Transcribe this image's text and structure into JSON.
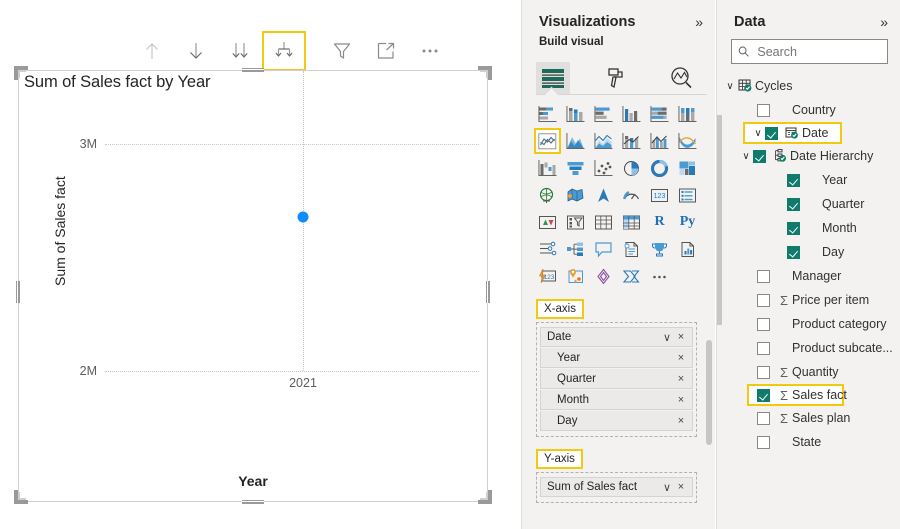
{
  "visual": {
    "title": "Sum of Sales fact by Year",
    "toolbar": [
      {
        "name": "drill-up-icon",
        "label": "Drill up",
        "state": "disabled",
        "selected": false
      },
      {
        "name": "drill-down-toggle-icon",
        "label": "Drill down",
        "state": "enabled",
        "selected": false
      },
      {
        "name": "go-to-next-level-icon",
        "label": "Go to the next level in the hierarchy",
        "state": "enabled",
        "selected": false
      },
      {
        "name": "expand-all-down-icon",
        "label": "Expand all down one level in the hierarchy",
        "state": "enabled",
        "selected": true
      },
      {
        "name": "filter-icon",
        "label": "Filters",
        "state": "enabled",
        "selected": false
      },
      {
        "name": "focus-mode-icon",
        "label": "Focus mode",
        "state": "enabled",
        "selected": false
      },
      {
        "name": "more-options-icon",
        "label": "More options",
        "state": "enabled",
        "selected": false
      }
    ]
  },
  "chart_data": {
    "type": "scatter",
    "title": "Sum of Sales fact by Year",
    "xlabel": "Year",
    "ylabel": "Sum of Sales fact",
    "x_ticks": [
      "2021"
    ],
    "y_ticks": [
      "2M",
      "3M"
    ],
    "ylim": [
      1800000,
      3200000
    ],
    "grid": true,
    "legend": false,
    "series": [
      {
        "name": "Sum of Sales fact",
        "color": "#118DFF",
        "points": [
          {
            "x": "2021",
            "y": 2500000
          }
        ]
      }
    ]
  },
  "visualizations_panel": {
    "title": "Visualizations",
    "collapse_label": "»",
    "build_visual_label": "Build visual",
    "tabs": [
      {
        "name": "build-visual-tab",
        "icon": "fields-grid-icon",
        "selected": true
      },
      {
        "name": "format-visual-tab",
        "icon": "paint-roller-icon",
        "selected": false
      },
      {
        "name": "analytics-tab",
        "icon": "magnifier-chart-icon",
        "selected": false
      }
    ],
    "gallery": [
      {
        "icon": "stacked-bar-chart-icon",
        "selected": false
      },
      {
        "icon": "stacked-column-chart-icon",
        "selected": false
      },
      {
        "icon": "clustered-bar-chart-icon",
        "selected": false
      },
      {
        "icon": "clustered-column-chart-icon",
        "selected": false
      },
      {
        "icon": "100-stacked-bar-chart-icon",
        "selected": false
      },
      {
        "icon": "100-stacked-column-chart-icon",
        "selected": false
      },
      {
        "icon": "line-chart-icon",
        "selected": true
      },
      {
        "icon": "area-chart-icon",
        "selected": false
      },
      {
        "icon": "stacked-area-chart-icon",
        "selected": false
      },
      {
        "icon": "line-and-stacked-column-chart-icon",
        "selected": false
      },
      {
        "icon": "line-and-clustered-column-chart-icon",
        "selected": false
      },
      {
        "icon": "ribbon-chart-icon",
        "selected": false
      },
      {
        "icon": "waterfall-chart-icon",
        "selected": false
      },
      {
        "icon": "funnel-icon",
        "selected": false
      },
      {
        "icon": "scatter-chart-icon",
        "selected": false
      },
      {
        "icon": "pie-chart-icon",
        "selected": false
      },
      {
        "icon": "donut-chart-icon",
        "selected": false
      },
      {
        "icon": "treemap-icon",
        "selected": false
      },
      {
        "icon": "map-icon",
        "selected": false
      },
      {
        "icon": "filled-map-icon",
        "selected": false
      },
      {
        "icon": "azure-map-icon",
        "selected": false
      },
      {
        "icon": "gauge-icon",
        "selected": false
      },
      {
        "icon": "card-icon",
        "selected": false
      },
      {
        "icon": "multi-row-card-icon",
        "selected": false
      },
      {
        "icon": "kpi-icon",
        "selected": false
      },
      {
        "icon": "slicer-icon",
        "selected": false
      },
      {
        "icon": "table-icon",
        "selected": false
      },
      {
        "icon": "matrix-icon",
        "selected": false
      },
      {
        "icon": "r-script-visual-icon",
        "selected": false
      },
      {
        "icon": "python-visual-icon",
        "selected": false
      },
      {
        "icon": "key-influencers-icon",
        "selected": false
      },
      {
        "icon": "decomposition-tree-icon",
        "selected": false
      },
      {
        "icon": "qa-visual-icon",
        "selected": false
      },
      {
        "icon": "narrative-icon",
        "selected": false
      },
      {
        "icon": "metrics-icon",
        "selected": false
      },
      {
        "icon": "paginated-report-icon",
        "selected": false
      },
      {
        "icon": "power-automate-number-icon",
        "selected": false
      },
      {
        "icon": "arcgis-map-icon",
        "selected": false
      },
      {
        "icon": "visio-icon",
        "selected": false
      },
      {
        "icon": "power-automate-icon",
        "selected": false
      },
      {
        "icon": "more-visuals-icon",
        "selected": false
      }
    ],
    "wells": [
      {
        "name": "x-axis",
        "label": "X-axis",
        "highlighted": true,
        "fields": [
          {
            "label": "Date",
            "level": 0,
            "has_chevron": true,
            "has_remove": true
          },
          {
            "label": "Year",
            "level": 1,
            "has_chevron": false,
            "has_remove": true
          },
          {
            "label": "Quarter",
            "level": 1,
            "has_chevron": false,
            "has_remove": true
          },
          {
            "label": "Month",
            "level": 1,
            "has_chevron": false,
            "has_remove": true
          },
          {
            "label": "Day",
            "level": 1,
            "has_chevron": false,
            "has_remove": true
          }
        ]
      },
      {
        "name": "y-axis",
        "label": "Y-axis",
        "highlighted": true,
        "fields": [
          {
            "label": "Sum of Sales fact",
            "level": 0,
            "has_chevron": true,
            "has_remove": true
          }
        ]
      }
    ],
    "chevron_glyph": "∨",
    "remove_glyph": "×"
  },
  "data_panel": {
    "title": "Data",
    "collapse_label": "»",
    "search": {
      "value": "",
      "placeholder": "Search",
      "icon": "search-icon"
    },
    "tree": [
      {
        "label": "Cycles",
        "indent": 0,
        "chevron": "expanded",
        "checkbox": "none",
        "icon": "table-badge-icon",
        "highlighted": false
      },
      {
        "label": "Country",
        "indent": 1,
        "chevron": "none",
        "checkbox": "off",
        "icon": "none",
        "highlighted": false
      },
      {
        "label": "Date",
        "indent": 1,
        "chevron": "expanded",
        "checkbox": "on",
        "icon": "date-table-badge-icon",
        "highlighted": true
      },
      {
        "label": "Date Hierarchy",
        "indent": 2,
        "chevron": "expanded",
        "checkbox": "on",
        "icon": "hierarchy-badge-icon",
        "highlighted": false
      },
      {
        "label": "Year",
        "indent": 3,
        "chevron": "none",
        "checkbox": "on",
        "icon": "none",
        "highlighted": false
      },
      {
        "label": "Quarter",
        "indent": 3,
        "chevron": "none",
        "checkbox": "on",
        "icon": "none",
        "highlighted": false
      },
      {
        "label": "Month",
        "indent": 3,
        "chevron": "none",
        "checkbox": "on",
        "icon": "none",
        "highlighted": false
      },
      {
        "label": "Day",
        "indent": 3,
        "chevron": "none",
        "checkbox": "on",
        "icon": "none",
        "highlighted": false
      },
      {
        "label": "Manager",
        "indent": 1,
        "chevron": "none",
        "checkbox": "off",
        "icon": "none",
        "highlighted": false
      },
      {
        "label": "Price per item",
        "indent": 1,
        "chevron": "none",
        "checkbox": "off",
        "icon": "sigma",
        "highlighted": false
      },
      {
        "label": "Product category",
        "indent": 1,
        "chevron": "none",
        "checkbox": "off",
        "icon": "none",
        "highlighted": false
      },
      {
        "label": "Product subcate...",
        "indent": 1,
        "chevron": "none",
        "checkbox": "off",
        "icon": "none",
        "highlighted": false
      },
      {
        "label": "Quantity",
        "indent": 1,
        "chevron": "none",
        "checkbox": "off",
        "icon": "sigma",
        "highlighted": false
      },
      {
        "label": "Sales fact",
        "indent": 1,
        "chevron": "none",
        "checkbox": "on",
        "icon": "sigma",
        "highlighted": true
      },
      {
        "label": "Sales plan",
        "indent": 1,
        "chevron": "none",
        "checkbox": "off",
        "icon": "sigma",
        "highlighted": false
      },
      {
        "label": "State",
        "indent": 1,
        "chevron": "none",
        "checkbox": "off",
        "icon": "none",
        "highlighted": false
      }
    ],
    "sigma_glyph": "Σ",
    "chevron_glyph": "∨"
  },
  "colors": {
    "highlight": "#F2C811",
    "datapoint": "#118DFF",
    "checkbox_on": "#0F7B6C",
    "panel_bg": "#F3F2F1"
  }
}
